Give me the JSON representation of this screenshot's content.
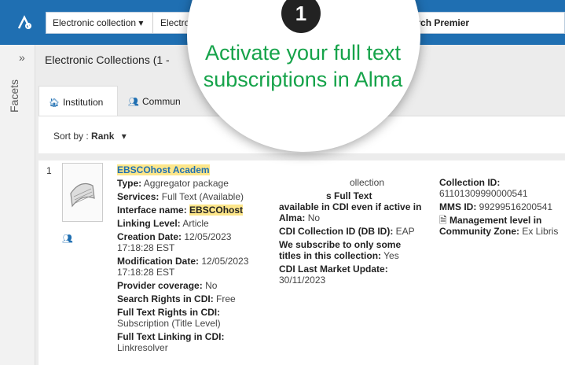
{
  "topbar": {
    "scope_label": "Electronic collection ▾",
    "scope_field": "Electronic C",
    "search_text": "Search Premier"
  },
  "facets": {
    "toggle": "»",
    "label": "Facets"
  },
  "results": {
    "title": "Electronic Collections (1 - "
  },
  "tabs": [
    {
      "label": "Institution",
      "icon": "home-icon"
    },
    {
      "label": "Commun",
      "icon": "users-icon"
    }
  ],
  "sort": {
    "label": "Sort by :",
    "value": "Rank",
    "caret": "▾"
  },
  "result": {
    "number": "1",
    "title": "EBSCOhost Academ",
    "col1": [
      {
        "label": "Type:",
        "value": "Aggregator package"
      },
      {
        "label": "Services:",
        "value": "Full Text (Available)"
      },
      {
        "label": "Interface name:",
        "value": "EBSCOhost"
      },
      {
        "label": "Linking Level:",
        "value": "Article"
      },
      {
        "label": "Creation Date:",
        "value": "12/05/2023 17:18:28 EST"
      },
      {
        "label": "Modification Date:",
        "value": "12/05/2023 17:18:28 EST"
      },
      {
        "label": "Provider coverage:",
        "value": "No"
      },
      {
        "label": "Search Rights in CDI:",
        "value": "Free"
      },
      {
        "label": "Full Text Rights in CDI:",
        "value": "Subscription (Title Level)"
      },
      {
        "label": "Full Text Linking in CDI:",
        "value": "Linkresolver"
      }
    ],
    "col2": {
      "partial_top": "ollection",
      "partial_label": "available in CDI even if active in Alma:",
      "partial_label_top": "s Full Text",
      "partial_value": "No",
      "cdi_label": "CDI Collection ID (DB ID):",
      "cdi_value": "EAP",
      "subscribe_label": "We subscribe to only some titles in this collection:",
      "subscribe_value": "Yes",
      "update_label": "CDI Last Market Update:",
      "update_value": "30/11/2023"
    },
    "col3": {
      "collection_id_label": "Collection ID:",
      "collection_id_value": "61101309990000541",
      "mms_label": "MMS ID:",
      "mms_value": "99299516200541",
      "mgmt_label": "Management level in Community Zone:",
      "mgmt_value": "Ex Libris"
    }
  },
  "callout": {
    "number": "1",
    "text": "Activate your full text subscriptions in Alma"
  }
}
